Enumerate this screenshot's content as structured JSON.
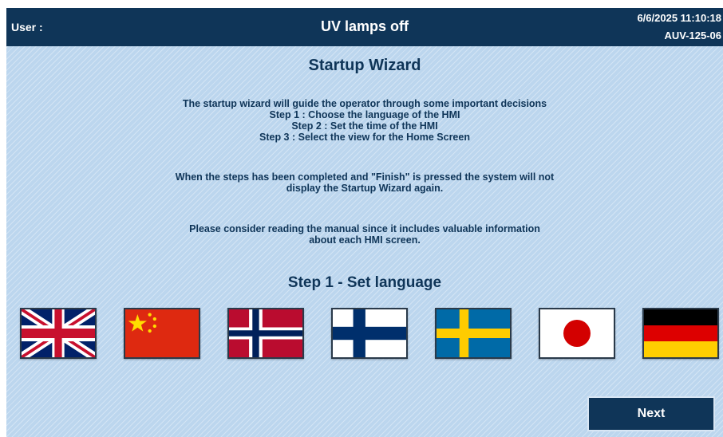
{
  "header": {
    "user_label": "User :",
    "status_title": "UV lamps off",
    "datetime": "6/6/2025 11:10:18",
    "machine_id": "AUV-125-06"
  },
  "wizard": {
    "title": "Startup Wizard",
    "intro_lines": [
      "The startup wizard will guide the operator through some important decisions",
      "Step 1 : Choose the language of the HMI",
      "Step 2 : Set the time of the HMI",
      "Step 3 : Select the view for the Home Screen"
    ],
    "finish_lines": [
      "When the steps has been completed and \"Finish\" is pressed the system will not",
      "display the Startup Wizard again."
    ],
    "manual_lines": [
      "Please consider reading the manual since it includes valuable information",
      "about each HMI screen."
    ],
    "step_title": "Step 1 - Set language",
    "languages": [
      {
        "icon": "uk-flag-icon"
      },
      {
        "icon": "china-flag-icon"
      },
      {
        "icon": "norway-flag-icon"
      },
      {
        "icon": "finland-flag-icon"
      },
      {
        "icon": "sweden-flag-icon"
      },
      {
        "icon": "japan-flag-icon"
      },
      {
        "icon": "germany-flag-icon"
      }
    ],
    "next_label": "Next"
  },
  "colors": {
    "header_bg": "#0f3558",
    "panel_bg": "#bcd6ee",
    "text": "#0f3558"
  }
}
